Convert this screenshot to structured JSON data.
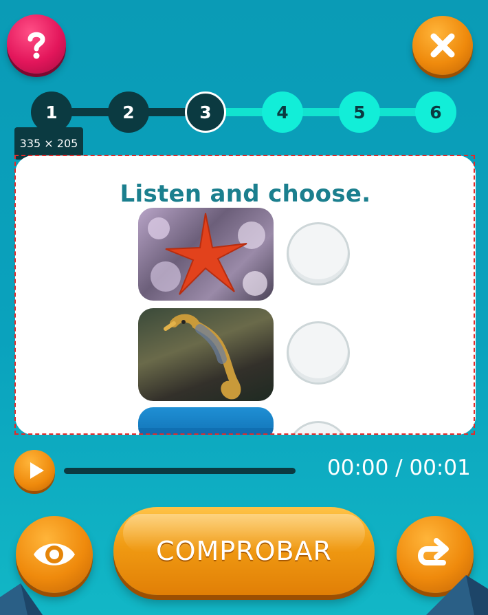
{
  "header": {
    "help_icon": "question-mark-icon",
    "close_icon": "close-x-icon"
  },
  "steps": [
    {
      "label": "1",
      "state": "done"
    },
    {
      "label": "2",
      "state": "done"
    },
    {
      "label": "3",
      "state": "current"
    },
    {
      "label": "4",
      "state": "todo"
    },
    {
      "label": "5",
      "state": "todo"
    },
    {
      "label": "6",
      "state": "todo"
    }
  ],
  "dimension_label": "335 × 205",
  "activity": {
    "instruction": "Listen and choose.",
    "options": [
      {
        "image": "starfish-photo",
        "selected": false
      },
      {
        "image": "seahorse-photo",
        "selected": false
      },
      {
        "image": "blue-water-photo",
        "selected": false
      }
    ]
  },
  "audio": {
    "play_icon": "play-icon",
    "progress": 0,
    "time": "00:00 / 00:01"
  },
  "footer": {
    "reveal_icon": "eye-icon",
    "check_label": "COMPROBAR",
    "retry_icon": "redo-arrow-icon"
  },
  "colors": {
    "background": "#0aa2bd",
    "accent_orange": "#ef8a0c",
    "help_pink": "#e3165b",
    "step_dark": "#0b3a41",
    "step_todo": "#12eed8",
    "title_teal": "#1b7f8e"
  }
}
